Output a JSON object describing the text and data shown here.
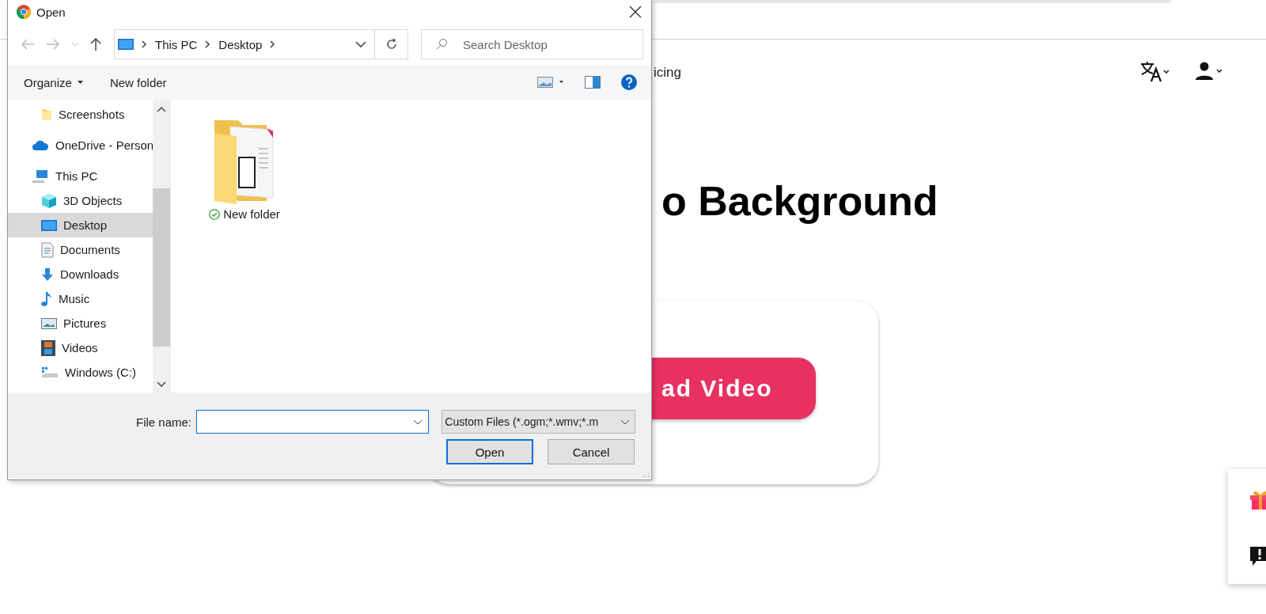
{
  "page": {
    "nav_text": "icing",
    "headline": "o Background",
    "upload_button": "ad Video"
  },
  "dialog": {
    "title": "Open",
    "breadcrumb": [
      "This PC",
      "Desktop"
    ],
    "search": {
      "placeholder": "Search Desktop"
    },
    "toolbar": [
      "Organize",
      "New folder"
    ],
    "nav": [
      {
        "children": [
          {
            "label": "Screenshots",
            "kind": "folder",
            "selected": false
          }
        ]
      },
      {
        "label": "OneDrive - Person",
        "kind": "cloud",
        "selected": false
      },
      {
        "label": "This PC",
        "kind": "pc",
        "selected": false,
        "children": [
          {
            "label": "3D Objects",
            "kind": "cube",
            "selected": false
          },
          {
            "label": "Desktop",
            "kind": "desktop",
            "selected": true
          },
          {
            "label": "Documents",
            "kind": "document",
            "selected": false
          },
          {
            "label": "Downloads",
            "kind": "download",
            "selected": false
          },
          {
            "label": "Music",
            "kind": "music",
            "selected": false
          },
          {
            "label": "Pictures",
            "kind": "pictures",
            "selected": false
          },
          {
            "label": "Videos",
            "kind": "videos",
            "selected": false
          },
          {
            "label": "Windows (C:)",
            "kind": "drive",
            "selected": false
          }
        ]
      }
    ],
    "files": [
      {
        "name": "New folder",
        "synced": true
      }
    ],
    "file_name_label": "File name:",
    "filter": "Custom Files (*.ogm;*.wmv;*.m",
    "buttons": [
      {
        "label": "Open",
        "default": true
      },
      {
        "label": "Cancel",
        "default": false
      }
    ]
  }
}
